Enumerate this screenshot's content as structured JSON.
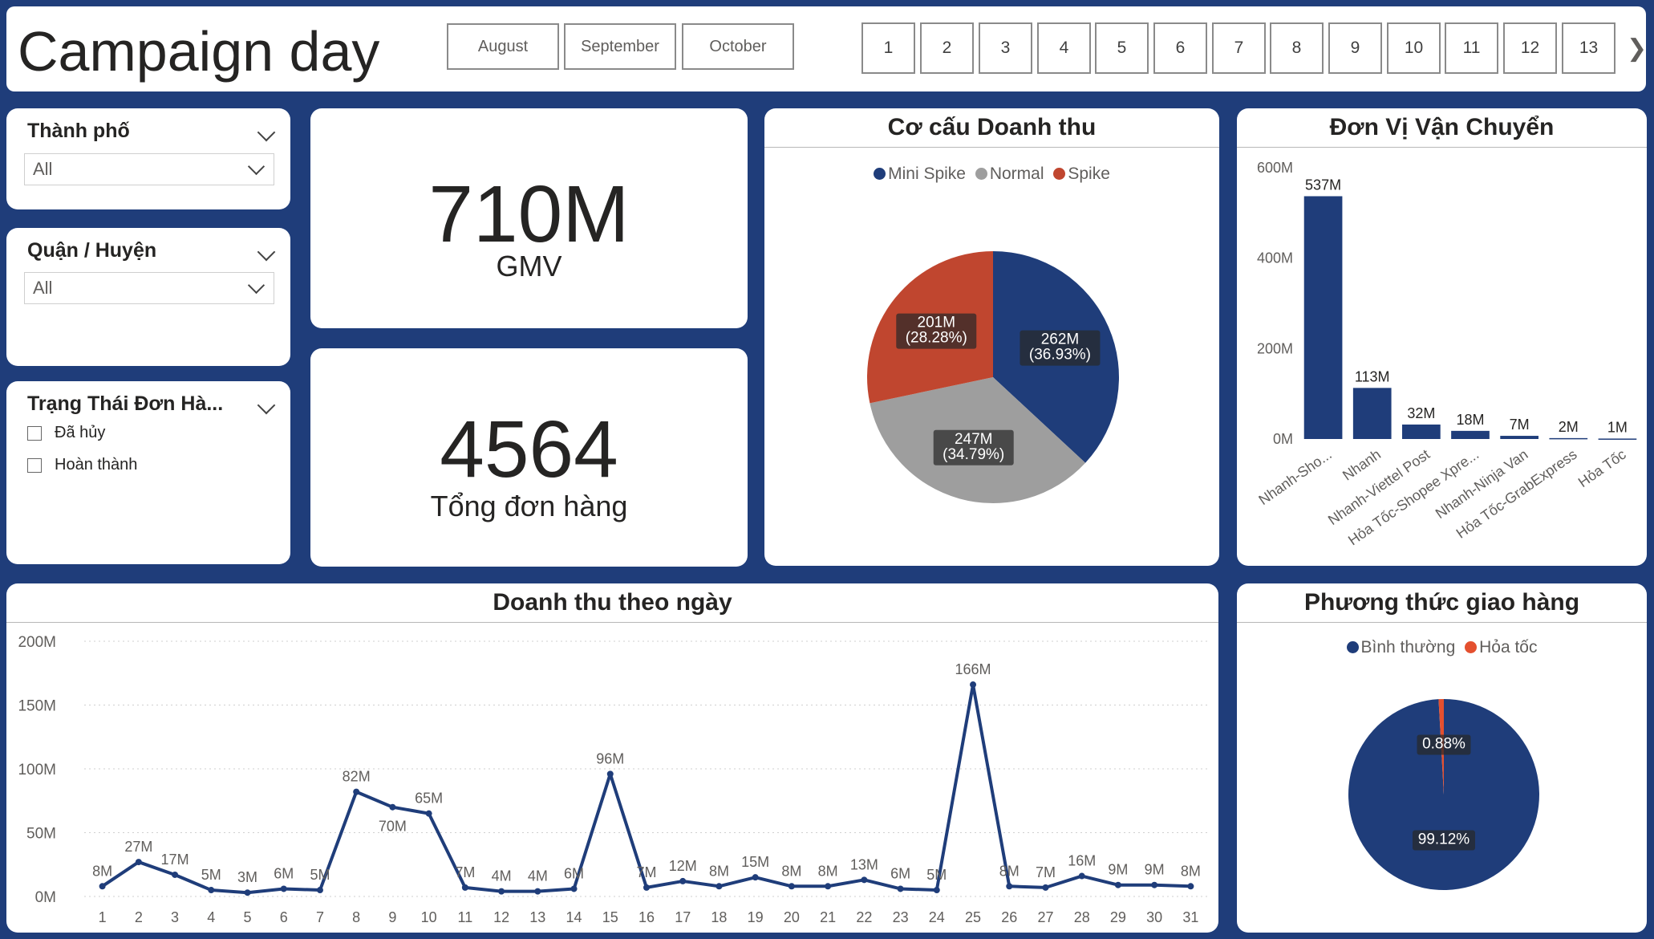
{
  "header": {
    "title": "Campaign day",
    "months": [
      "August",
      "September",
      "October"
    ],
    "days": [
      "1",
      "2",
      "3",
      "4",
      "5",
      "6",
      "7",
      "8",
      "9",
      "10",
      "11",
      "12",
      "13"
    ],
    "next_icon": "chevron-right-icon"
  },
  "slicers": {
    "city": {
      "title": "Thành phố",
      "value": "All"
    },
    "district": {
      "title": "Quận / Huyện",
      "value": "All"
    },
    "status": {
      "title": "Trạng Thái Đơn Hà...",
      "options": [
        "Đã hủy",
        "Hoàn thành"
      ]
    }
  },
  "kpis": {
    "gmv": {
      "value": "710M",
      "label": "GMV"
    },
    "orders": {
      "value": "4564",
      "label": "Tổng đơn hàng"
    }
  },
  "colors": {
    "navy": "#1f3d7a",
    "gray": "#9e9e9e",
    "red": "#c0462f",
    "orange_red": "#e4502f"
  },
  "chart_data": [
    {
      "id": "revenue_structure",
      "type": "pie",
      "title": "Cơ cấu Doanh thu",
      "legend_position": "top",
      "slices": [
        {
          "name": "Mini Spike",
          "value": 262,
          "label": "262M",
          "percent": "(36.93%)",
          "color": "#1f3d7a"
        },
        {
          "name": "Normal",
          "value": 247,
          "label": "247M",
          "percent": "(34.79%)",
          "color": "#9e9e9e"
        },
        {
          "name": "Spike",
          "value": 201,
          "label": "201M",
          "percent": "(28.28%)",
          "color": "#c0462f"
        }
      ]
    },
    {
      "id": "carriers",
      "type": "bar",
      "title": "Đơn Vị Vận Chuyển",
      "categories": [
        "Nhanh-Sho...",
        "Nhanh",
        "Nhanh-Viettel Post",
        "Hỏa Tốc-Shopee Xpre...",
        "Nhanh-Ninja Van",
        "Hỏa Tốc-GrabExpress",
        "Hỏa Tốc"
      ],
      "values": [
        537,
        113,
        32,
        18,
        7,
        2,
        1
      ],
      "data_labels": [
        "537M",
        "113M",
        "32M",
        "18M",
        "7M",
        "2M",
        "1M"
      ],
      "yticks": [
        "0M",
        "200M",
        "400M",
        "600M"
      ],
      "ylim": [
        0,
        600
      ],
      "grid": false
    },
    {
      "id": "daily_revenue",
      "type": "line",
      "title": "Doanh thu theo ngày",
      "x": [
        1,
        2,
        3,
        4,
        5,
        6,
        7,
        8,
        9,
        10,
        11,
        12,
        13,
        14,
        15,
        16,
        17,
        18,
        19,
        20,
        21,
        22,
        23,
        24,
        25,
        26,
        27,
        28,
        29,
        30,
        31
      ],
      "values": [
        8,
        27,
        17,
        5,
        3,
        6,
        5,
        82,
        70,
        65,
        7,
        4,
        4,
        6,
        96,
        7,
        12,
        8,
        15,
        8,
        8,
        13,
        6,
        5,
        166,
        8,
        7,
        16,
        9,
        9,
        8
      ],
      "data_labels": [
        "8M",
        "27M",
        "17M",
        "5M",
        "3M",
        "6M",
        "5M",
        "82M",
        "70M",
        "65M",
        "7M",
        "4M",
        "4M",
        "6M",
        "96M",
        "7M",
        "12M",
        "8M",
        "15M",
        "8M",
        "8M",
        "13M",
        "6M",
        "5M",
        "166M",
        "8M",
        "7M",
        "16M",
        "9M",
        "9M",
        "8M"
      ],
      "yticks": [
        "0M",
        "50M",
        "100M",
        "150M",
        "200M"
      ],
      "ylim": [
        0,
        200
      ],
      "grid": true
    },
    {
      "id": "delivery_method",
      "type": "pie",
      "title": "Phương thức giao hàng",
      "legend_position": "top",
      "slices": [
        {
          "name": "Bình thường",
          "value": 99.12,
          "label": "99.12%",
          "color": "#1f3d7a"
        },
        {
          "name": "Hỏa tốc",
          "value": 0.88,
          "label": "0.88%",
          "color": "#e4502f"
        }
      ]
    }
  ]
}
